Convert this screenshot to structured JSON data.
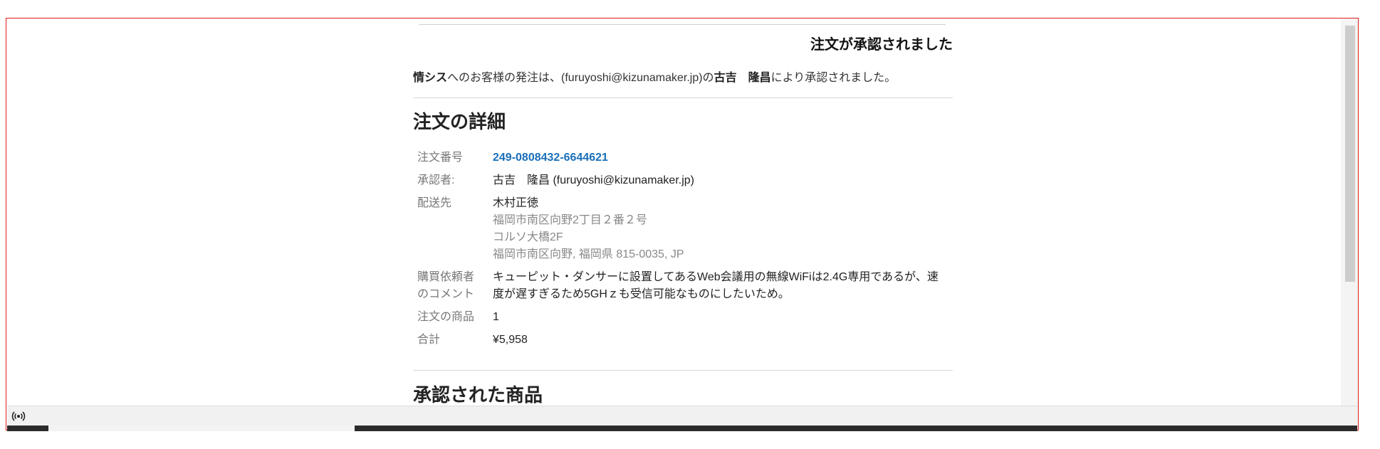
{
  "header": {
    "title": "注文が承認されました"
  },
  "intro": {
    "org": "情シス",
    "text1": "へのお客様の発注は、(furuyoshi@kizunamaker.jp)の",
    "approver": "古吉　隆昌",
    "text2": "により承認されました。"
  },
  "details": {
    "section_title": "注文の詳細",
    "order_number_label": "注文番号",
    "order_number": "249-0808432-6644621",
    "approver_label": "承認者:",
    "approver_value": "古吉　隆昌 (furuyoshi@kizunamaker.jp)",
    "ship_to_label": "配送先",
    "ship_name": "木村正徳",
    "ship_line1": "福岡市南区向野2丁目２番２号",
    "ship_line2": "コルソ大橋2F",
    "ship_line3": "福岡市南区向野, 福岡県 815-0035, JP",
    "comment_label": "購買依頼者のコメント",
    "comment": "キューピット・ダンサーに設置してあるWeb会議用の無線WiFiは2.4G専用であるが、速度が遅すぎるため5GHｚも受信可能なものにしたいため。",
    "items_label": "注文の商品",
    "items_value": "1",
    "total_label": "合計",
    "total_value": "¥5,958"
  },
  "approved_items": {
    "section_title": "承認された商品"
  },
  "icons": {
    "status": "broadcast-icon",
    "scroll_down": "chevron-down-icon"
  },
  "colors": {
    "frame": "#e01b1b",
    "link": "#1a6fb8"
  }
}
